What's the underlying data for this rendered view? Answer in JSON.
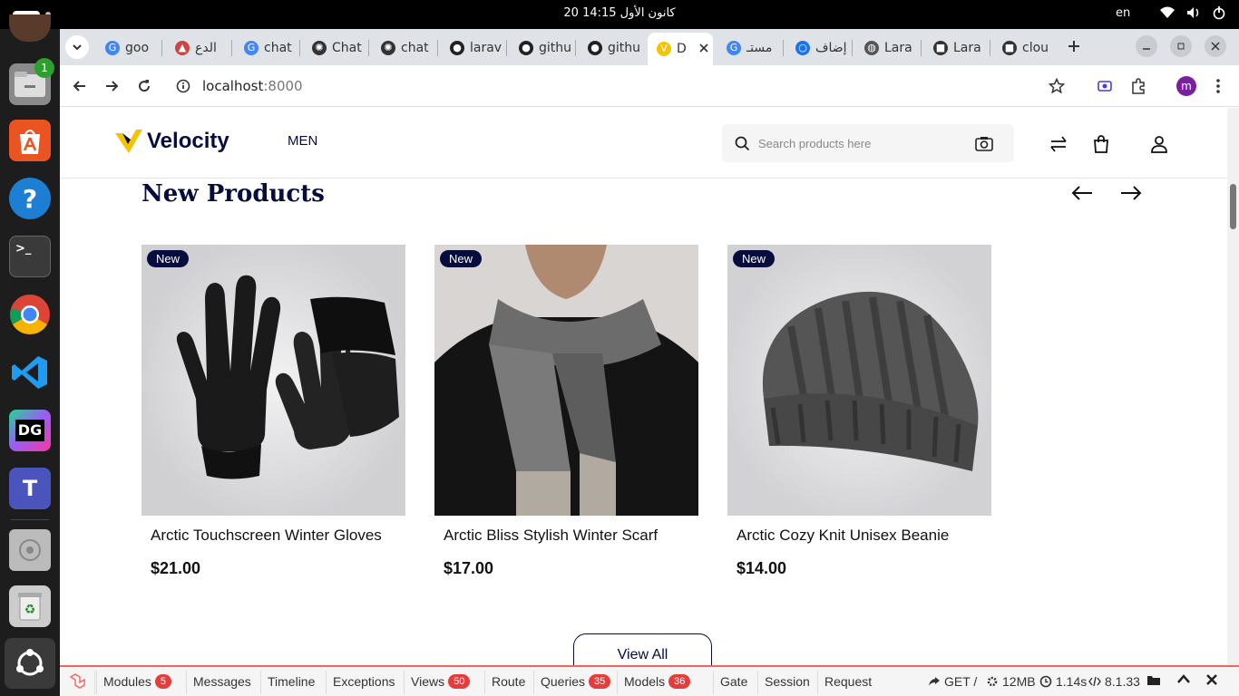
{
  "system": {
    "clock": "20 كانون الأول  14:15",
    "lang": "en"
  },
  "tabs": [
    {
      "label": "goo",
      "icon": "google-icon"
    },
    {
      "label": "الدع",
      "icon": "site-icon"
    },
    {
      "label": "chat",
      "icon": "google-icon"
    },
    {
      "label": "Chat",
      "icon": "openai-icon"
    },
    {
      "label": "chat",
      "icon": "openai-icon"
    },
    {
      "label": "larav",
      "icon": "github-icon"
    },
    {
      "label": "githu",
      "icon": "github-icon"
    },
    {
      "label": "githu",
      "icon": "github-icon"
    },
    {
      "label": "D",
      "icon": "velocity-icon"
    },
    {
      "label": "مستـ",
      "icon": "google-icon"
    },
    {
      "label": "إضاف",
      "icon": "extension-icon"
    },
    {
      "label": "Lara",
      "icon": "globe-icon"
    },
    {
      "label": "Lara",
      "icon": "laravel-cloud-icon"
    },
    {
      "label": "clou",
      "icon": "laravel-cloud-icon"
    }
  ],
  "address": {
    "host": "localhost",
    "port": ":8000"
  },
  "site": {
    "logo": "Velocity",
    "nav_men": "MEN",
    "search_placeholder": "Search products here"
  },
  "section": {
    "title": "New Products",
    "view_all": "View All"
  },
  "products": [
    {
      "badge": "New",
      "name": "Arctic Touchscreen Winter Gloves",
      "price": "$21.00"
    },
    {
      "badge": "New",
      "name": "Arctic Bliss Stylish Winter Scarf",
      "price": "$17.00"
    },
    {
      "badge": "New",
      "name": "Arctic Cozy Knit Unisex Beanie",
      "price": "$14.00"
    }
  ],
  "debugbar": {
    "items": [
      {
        "label": "Modules",
        "count": "5"
      },
      {
        "label": "Messages",
        "count": ""
      },
      {
        "label": "Timeline",
        "count": ""
      },
      {
        "label": "Exceptions",
        "count": ""
      },
      {
        "label": "Views",
        "count": "50"
      },
      {
        "label": "Route",
        "count": ""
      },
      {
        "label": "Queries",
        "count": "35"
      },
      {
        "label": "Models",
        "count": "36"
      },
      {
        "label": "Gate",
        "count": ""
      },
      {
        "label": "Session",
        "count": ""
      },
      {
        "label": "Request",
        "count": ""
      }
    ],
    "method": "GET /",
    "memory": "12MB",
    "time": "1.14s",
    "php": "8.1.33"
  },
  "dock_badge": "1",
  "colors": {
    "brand": "#060c3b",
    "accent": "#f4c400",
    "debug_red": "#e83b3b"
  }
}
